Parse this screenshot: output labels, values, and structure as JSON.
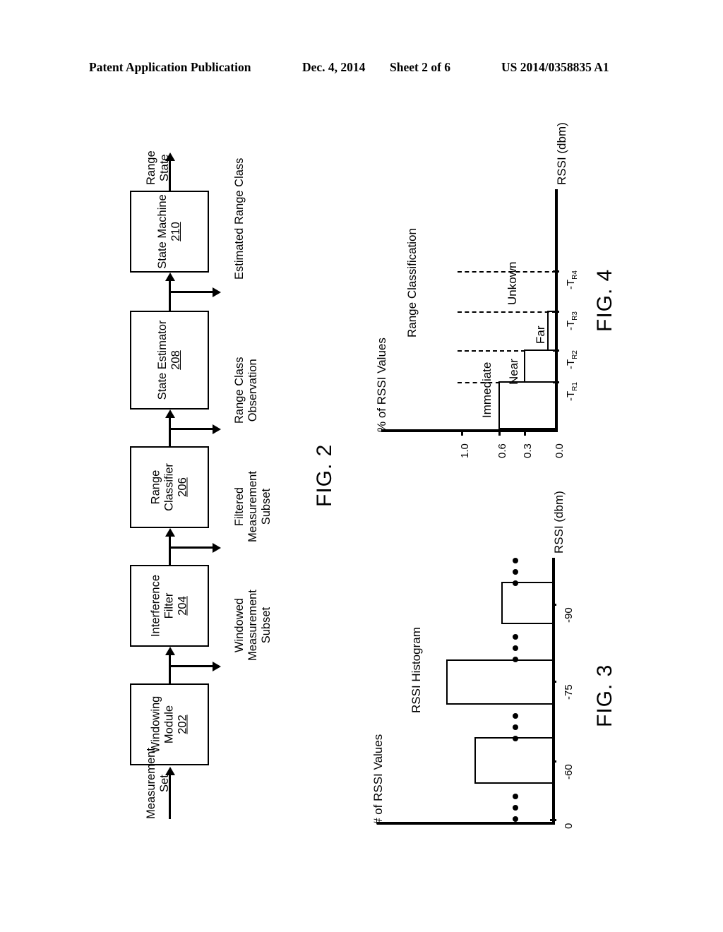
{
  "header": {
    "title": "Patent Application Publication",
    "date": "Dec. 4, 2014",
    "sheet": "Sheet 2 of 6",
    "number": "US 2014/0358835 A1"
  },
  "fig2": {
    "label": "FIG. 2",
    "input_label": "Measurement\nSet",
    "output_label": "Range\nState",
    "blocks": [
      {
        "name": "Windowing\nModule",
        "ref": "202"
      },
      {
        "name": "Interference\nFilter",
        "ref": "204"
      },
      {
        "name": "Range\nClassifier",
        "ref": "206"
      },
      {
        "name": "State Estimator",
        "ref": "208"
      },
      {
        "name": "State Machine",
        "ref": "210"
      }
    ],
    "signals": [
      "Windowed\nMeasurement\nSubset",
      "Filtered\nMeasurement\nSubset",
      "Range Class\nObservation",
      "Estimated Range Class"
    ]
  },
  "fig3": {
    "label": "FIG. 3",
    "chart_data": {
      "type": "bar",
      "title": "RSSI Histogram",
      "xlabel": "RSSI (dbm)",
      "ylabel": "# of RSSI Values",
      "categories": [
        "-60",
        "-75",
        "-90"
      ],
      "tick_labels": [
        "0",
        "-60",
        "-75",
        "-90"
      ],
      "values": [
        0.62,
        0.92,
        0.45
      ],
      "ylim": [
        0,
        1
      ],
      "grid": false,
      "legend": "none",
      "ellipsis_groups": 4,
      "ellipsis_note": "vertical three-dot ellipses between and around bars indicating omitted bins"
    }
  },
  "fig4": {
    "label": "FIG. 4",
    "chart_data": {
      "type": "bar",
      "title": "Range Classification",
      "xlabel": "RSSI (dbm)",
      "ylabel": "% of RSSI Values",
      "categories": [
        "Immediate",
        "Near",
        "Far",
        "Unkown"
      ],
      "values": [
        0.6,
        0.3,
        0.1,
        0.0
      ],
      "thresholds": [
        "-T_R1",
        "-T_R2",
        "-T_R3",
        "-T_R4"
      ],
      "threshold_display": [
        {
          "pre": "-T",
          "sub": "R1"
        },
        {
          "pre": "-T",
          "sub": "R2"
        },
        {
          "pre": "-T",
          "sub": "R3"
        },
        {
          "pre": "-T",
          "sub": "R4"
        }
      ],
      "tick_labels": [
        "1.0",
        "0.6",
        "0.3",
        "0.0"
      ],
      "tick_values": [
        1.0,
        0.6,
        0.3,
        0.0
      ],
      "ylim": [
        0,
        1.0
      ],
      "grid": false,
      "legend": "none",
      "annotation": "dashed leader lines connect each step level to the 1.0 reference"
    }
  }
}
